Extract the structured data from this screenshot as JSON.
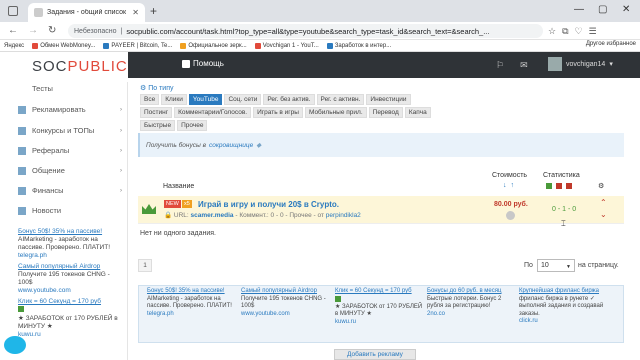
{
  "browser": {
    "tab_title": "Задания - общий список задан",
    "insecure_label": "Небезопасно",
    "url": "socpublic.com/account/task.html?top_type=all&type=youtube&search_type=task_id&search_text=&search_...",
    "bookmarks": [
      "Яндекс",
      "Обмен WebMoney...",
      "PAYEER | Bitcoin, Te...",
      "Официальное зерк...",
      "Vovchigan 1 - YouT...",
      "Заработок в интер..."
    ],
    "other_bookmarks": "Другое избранное"
  },
  "site": {
    "logo_a": "SOC",
    "logo_b": "PUBLIC",
    "help_label": "Помощь",
    "username": "vovchigan14"
  },
  "sidebar": {
    "items": [
      {
        "label": "Тесты"
      },
      {
        "label": "Рекламировать"
      },
      {
        "label": "Конкурсы и ТОПы"
      },
      {
        "label": "Рефералы"
      },
      {
        "label": "Общение"
      },
      {
        "label": "Финансы"
      },
      {
        "label": "Новости"
      }
    ],
    "ads": [
      {
        "title": "Бонус 50$! 35% на пассиве!",
        "text": "AIMarketing - заработок на пассиве. Проверено. ПЛАТИТ!",
        "src": "telegra.ph"
      },
      {
        "title": "Самый популярный Airdrop",
        "text": "Получите 195 токенов CHNG - 100$",
        "src": "www.youtube.com"
      },
      {
        "title": "Клик = 60 Секунд = 170 руб",
        "text": "★ ЗАРАБОТОК от 170 РУБЛЕЙ в МИНУТУ ★",
        "src": "kuwu.ru"
      }
    ]
  },
  "filters": {
    "label": "По типу",
    "chips": [
      "Все",
      "Клики",
      "YouTube",
      "Соц. сети",
      "Рег. без актив.",
      "Рег. с активн.",
      "Инвестиции",
      "Постинг",
      "Комментарии/Голосов.",
      "Играть в игры",
      "Мобильные прил.",
      "Перевод",
      "Капча",
      "Быстрые",
      "Прочее"
    ],
    "active": "YouTube"
  },
  "bonus": {
    "text": "Получить бонусы в",
    "link": "сокровищнице"
  },
  "table": {
    "col_name": "Название",
    "col_cost": "Стоимость",
    "col_stats": "Статистика"
  },
  "task": {
    "badge_new": "NEW",
    "badge_x": "x5",
    "title": "Играй в игру и получи 20$ в Crypto.",
    "url_label": "URL:",
    "url": "scamer.media",
    "meta_rest": "- Коммент.: 0 - 0 - Прочее - от",
    "author": "perpindikla2",
    "price": "80.00 руб.",
    "stats": "0 - 1 - 0"
  },
  "empty_text": "Нет ни одного задания.",
  "pagination": {
    "page": "1",
    "per_page_label": "По",
    "per_page_value": "10",
    "per_page_suffix": "на страницу."
  },
  "ad_panel": [
    {
      "title": "Бонус 50$! 35% на пассиве!",
      "text": "AIMarketing - заработок на пассиве. Проверено. ПЛАТИТ!",
      "src": "telegra.ph"
    },
    {
      "title": "Самый популярный Airdrop",
      "text": "Получите 195 токенов CHNG - 100$",
      "src": "www.youtube.com"
    },
    {
      "title": "Клик = 60 Секунд = 170 руб",
      "text": "★ ЗАРАБОТОК от 170 РУБЛЕЙ в МИНУТУ ★",
      "src": "kuwu.ru"
    },
    {
      "title": "Бонусы до 60 руб. в месяц",
      "text": "Быстрые лотереи. Бонус 2 рубля за регистрацию!",
      "src": "2no.co"
    },
    {
      "title": "Крупнейшая фриланс биржа",
      "text": "фриланс биржа в рунете ✓ выполняй задания и создавай заказы.",
      "src": "click.ru"
    }
  ],
  "add_ad_label": "Добавить рекламу",
  "colors": {
    "header": "#2f3337",
    "accent": "#2a7abf",
    "logo_red": "#e14a3b",
    "task_bg": "#fdf6d8"
  }
}
